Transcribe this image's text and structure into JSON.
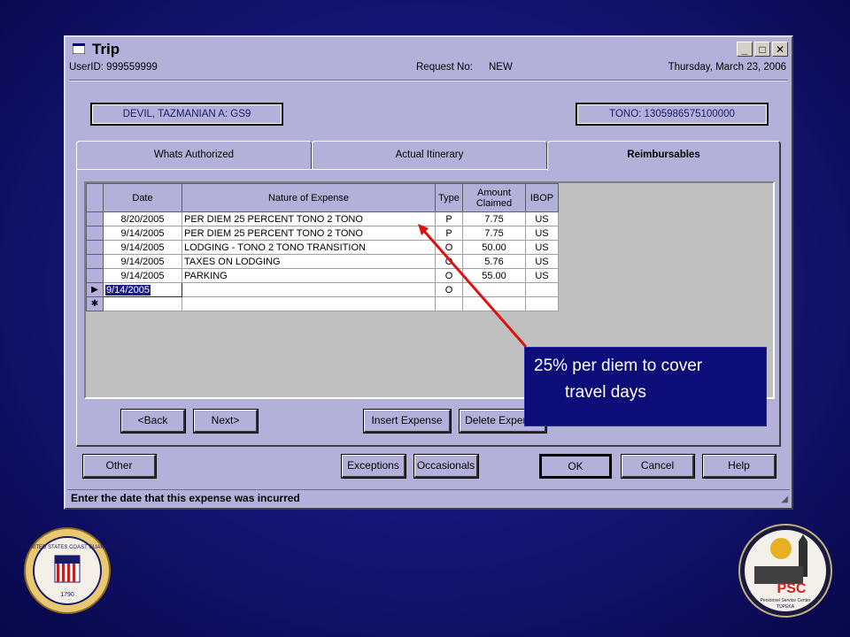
{
  "window": {
    "title": "Trip",
    "controls": {
      "minimize": "_",
      "maximize": "□",
      "close": "✕"
    },
    "user_id": "UserID:  999559999",
    "request_label": "Request No:",
    "request_value": "NEW",
    "date": "Thursday, March 23, 2006"
  },
  "traveler": {
    "name": "DEVIL, TAZMANIAN A: GS9",
    "tono": "TONO: 1305986575100000"
  },
  "tabs": [
    {
      "label": "Whats Authorized"
    },
    {
      "label": "Actual Itinerary"
    },
    {
      "label": "Reimbursables"
    }
  ],
  "grid": {
    "headers": {
      "date": "Date",
      "nature": "Nature of Expense",
      "type": "Type",
      "amount": "Amount\nClaimed",
      "ibop": "IBOP"
    },
    "rows": [
      {
        "date": "8/20/2005",
        "nature": "PER DIEM 25 PERCENT TONO 2 TONO",
        "type": "P",
        "amount": "7.75",
        "ibop": "US"
      },
      {
        "date": "9/14/2005",
        "nature": "PER DIEM 25 PERCENT TONO 2 TONO",
        "type": "P",
        "amount": "7.75",
        "ibop": "US"
      },
      {
        "date": "9/14/2005",
        "nature": "LODGING - TONO 2 TONO TRANSITION",
        "type": "O",
        "amount": "50.00",
        "ibop": "US"
      },
      {
        "date": "9/14/2005",
        "nature": "TAXES ON LODGING",
        "type": "O",
        "amount": "5.76",
        "ibop": "US"
      },
      {
        "date": "9/14/2005",
        "nature": "PARKING",
        "type": "O",
        "amount": "55.00",
        "ibop": "US"
      }
    ],
    "current_row": {
      "date": "9/14/2005",
      "type": "O",
      "indicator": "▶"
    },
    "new_row_indicator": "✱"
  },
  "tab_buttons": {
    "back": "<Back",
    "next": "Next>",
    "insert": "Insert Expense",
    "delete": "Delete Expense"
  },
  "bottom_buttons": {
    "other": "Other",
    "exceptions": "Exceptions",
    "occasionals": "Occasionals",
    "ok": "OK",
    "cancel": "Cancel",
    "help": "Help"
  },
  "status": "Enter the date that this expense was incurred",
  "callout": {
    "line1": "25% per diem to cover",
    "line2": "travel days"
  },
  "colors": {
    "background": "#16167a",
    "window": "#b3b0d9",
    "callout": "#0d0d7a",
    "arrow": "#e01010"
  },
  "logos": {
    "left": {
      "text": "UNITED STATES COAST GUARD",
      "year": "1790"
    },
    "right": {
      "text": "PSC",
      "subtext": "Personnel Service Center",
      "city": "TOPEKA"
    }
  }
}
